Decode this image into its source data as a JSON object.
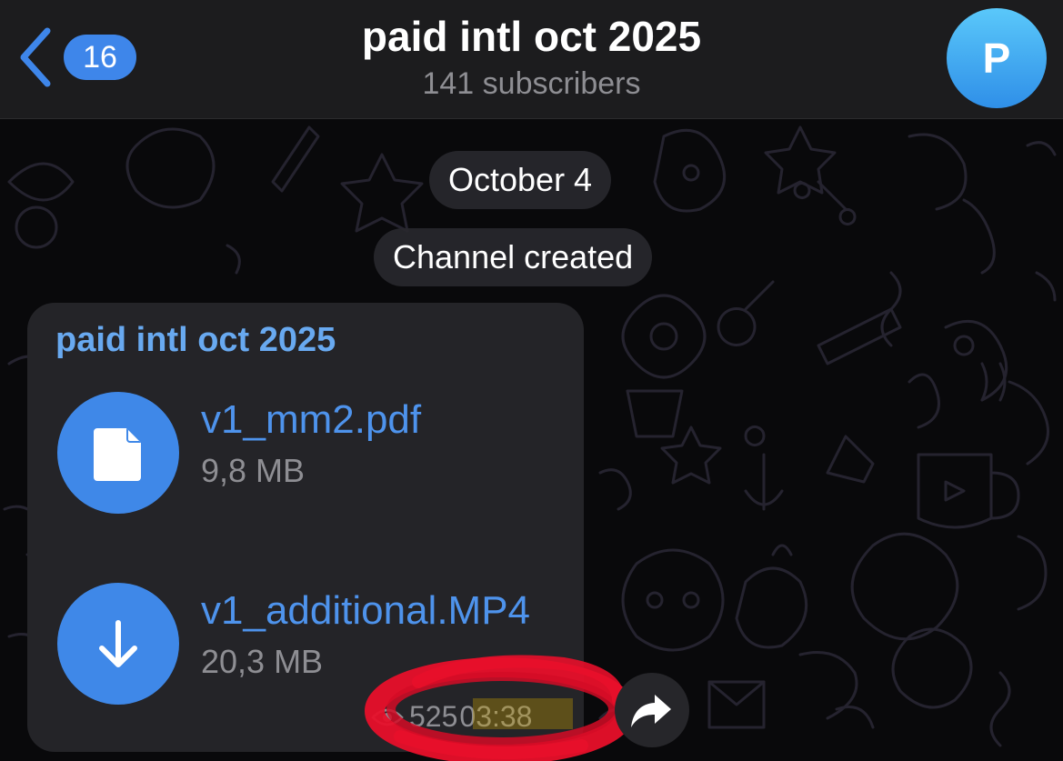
{
  "header": {
    "back_badge_count": "16",
    "title": "paid intl oct 2025",
    "subtitle": "141 subscribers",
    "avatar_letter": "P"
  },
  "service_messages": {
    "date": "October 4",
    "created": "Channel created"
  },
  "message": {
    "sender": "paid intl oct 2025",
    "files": [
      {
        "name": "v1_mm2.pdf",
        "size": "9,8 MB",
        "icon": "document-icon"
      },
      {
        "name": "v1_additional.MP4",
        "size": "20,3 MB",
        "icon": "download-arrow-icon"
      }
    ],
    "views": "525",
    "time": "03:38"
  },
  "colors": {
    "accent": "#3f88e8",
    "link_text": "#4e93ec",
    "sender_name": "#68a9f0",
    "bubble": "#242428",
    "header": "#1c1c1e",
    "scribble": "#e8102a"
  }
}
